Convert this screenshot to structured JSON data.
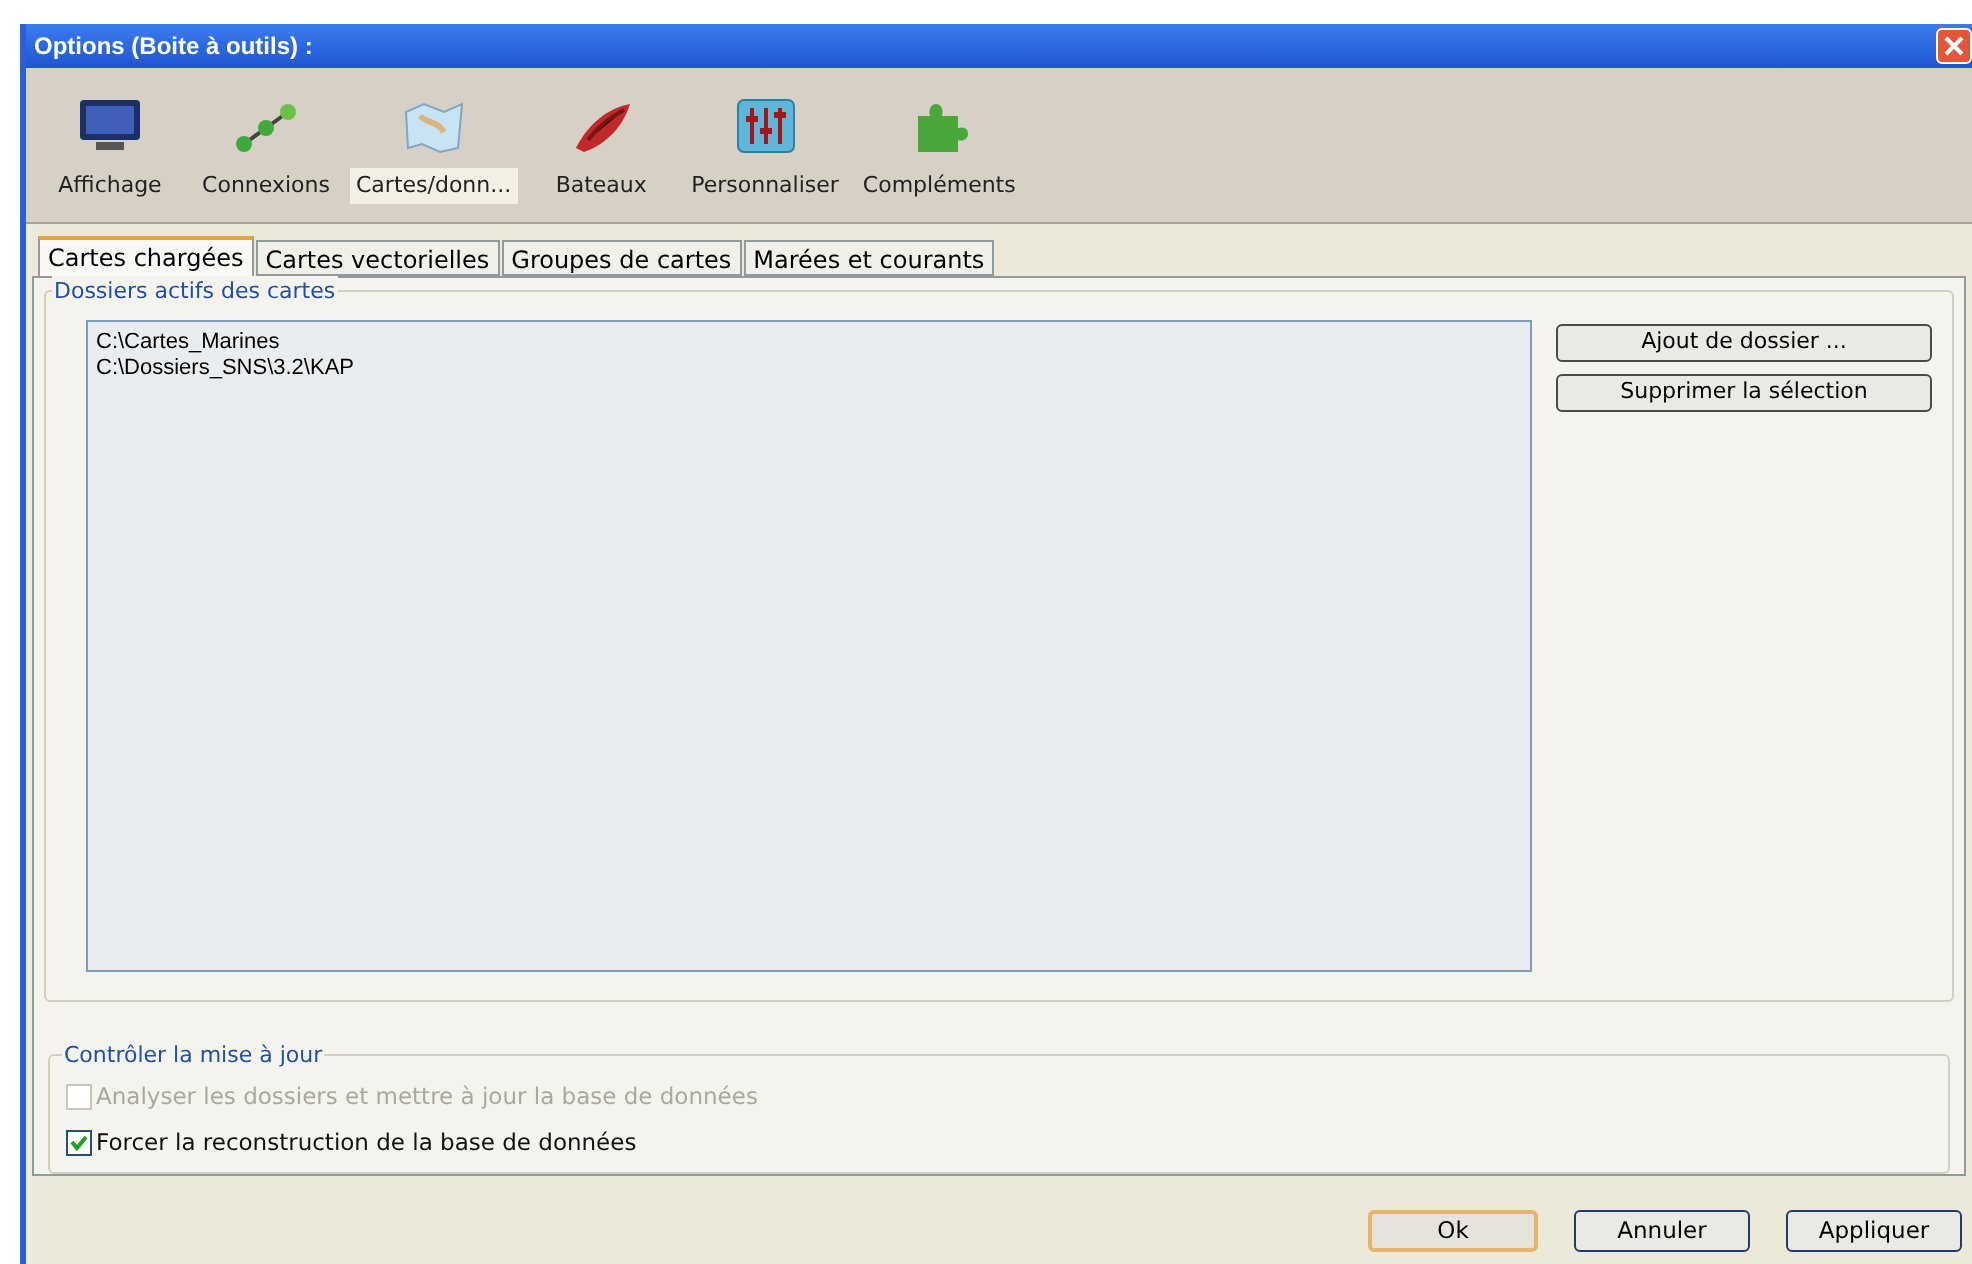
{
  "window": {
    "title": "Options (Boite à outils) :"
  },
  "toolbar": [
    {
      "label": "Affichage",
      "selected": false
    },
    {
      "label": "Connexions",
      "selected": false
    },
    {
      "label": "Cartes/donn...",
      "selected": true
    },
    {
      "label": "Bateaux",
      "selected": false
    },
    {
      "label": "Personnaliser",
      "selected": false
    },
    {
      "label": "Compléments",
      "selected": false
    }
  ],
  "tabs": [
    {
      "label": "Cartes chargées",
      "selected": true
    },
    {
      "label": "Cartes vectorielles",
      "selected": false
    },
    {
      "label": "Groupes de cartes",
      "selected": false
    },
    {
      "label": "Marées et courants",
      "selected": false
    }
  ],
  "folders_group": {
    "title": "Dossiers actifs des cartes",
    "items": [
      "C:\\Cartes_Marines",
      "C:\\Dossiers_SNS\\3.2\\KAP"
    ],
    "buttons": [
      "Ajout de dossier ...",
      "Supprimer la sélection"
    ]
  },
  "update_group": {
    "title": "Contrôler la mise à jour",
    "options": [
      {
        "label": "Analyser les dossiers et mettre à jour la base de données",
        "checked": false,
        "disabled": true
      },
      {
        "label": "Forcer la reconstruction de la base de données",
        "checked": true,
        "disabled": false
      }
    ]
  },
  "buttons": [
    {
      "label": "Ok",
      "default": true
    },
    {
      "label": "Annuler",
      "default": false
    },
    {
      "label": "Appliquer",
      "default": false
    }
  ]
}
